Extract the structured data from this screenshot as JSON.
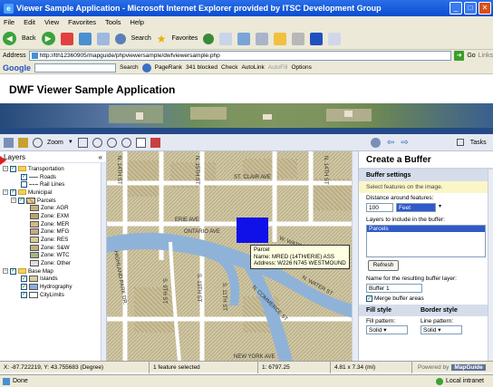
{
  "window": {
    "title": "Viewer Sample Application - Microsoft Internet Explorer provided by ITSC Development Group"
  },
  "menu": [
    "File",
    "Edit",
    "View",
    "Favorites",
    "Tools",
    "Help"
  ],
  "toolbar": {
    "back": "Back",
    "search": "Search",
    "favorites": "Favorites"
  },
  "address": {
    "label": "Address",
    "url": "http://lth12360905/mapguide/phpviewersample/dwfviewersample.php",
    "go": "Go",
    "links": "Links"
  },
  "google": {
    "logo": "Google",
    "search": "Search",
    "pagerank": "PageRank",
    "blocked": "341 blocked",
    "check": "Check",
    "autolink": "AutoLink",
    "autofill": "AutoFill",
    "options": "Options"
  },
  "app": {
    "title": "DWF Viewer Sample Application"
  },
  "maptoolbar": {
    "zoom": "Zoom"
  },
  "tasks": {
    "label": "Tasks"
  },
  "layers": {
    "title": "Layers",
    "groups": [
      {
        "name": "Transportation",
        "items": [
          "Roads",
          "Rail Lines"
        ]
      },
      {
        "name": "Municipal",
        "sub": "Parcels",
        "zones": [
          {
            "label": "Zone: AGR",
            "color": "#c8b27c"
          },
          {
            "label": "Zone: EXM",
            "color": "#b6a66e"
          },
          {
            "label": "Zone: MER",
            "color": "#d6b98a"
          },
          {
            "label": "Zone: MFG",
            "color": "#c9a986"
          },
          {
            "label": "Zone: RES",
            "color": "#d8cc9c"
          },
          {
            "label": "Zone: S&W",
            "color": "#bfb07e"
          },
          {
            "label": "Zone: WTC",
            "color": "#a8b484"
          },
          {
            "label": "Zone: Other",
            "color": "#e0e0e0"
          }
        ]
      },
      {
        "name": "Base Map",
        "items": [
          "Islands",
          "Hydrography",
          "CityLimits"
        ]
      }
    ]
  },
  "map": {
    "streets": [
      "ST. CLAIR AVE",
      "ERIE AVE",
      "ONTARIO AVE",
      "W. WATER ST",
      "N. WATER ST",
      "N. COMMERCE ST",
      "NEW YORK AVE",
      "HIGHLAND PARK DR.",
      "N. 14TH ST",
      "N. 15TH ST",
      "N. 14TH ST",
      "S. 13TH ST",
      "S. 11TH ST",
      "S. 9TH ST"
    ],
    "tooltip": {
      "title": "Parcel",
      "name": "Name: MRED (14TH/ERIE) ASS",
      "address": "Address: W226 N745 WESTMOUND"
    }
  },
  "taskpane": {
    "title": "Create a Buffer",
    "section1": "Buffer settings",
    "note": "Select features on the image.",
    "distance_label": "Distance around features:",
    "distance_value": "100",
    "unit": "Feet",
    "layers_label": "Layers to include in the buffer:",
    "layer_option": "Parcels",
    "refresh": "Refresh",
    "name_label": "Name for the resulting buffer layer:",
    "name_value": "Buffer 1",
    "merge": "Merge buffer areas",
    "fill_style": "Fill style",
    "border_style": "Border style",
    "fill_pattern": "Fill pattern:",
    "line_pattern": "Line pattern:",
    "solid1": "Solid",
    "solid2": "Solid"
  },
  "status": {
    "coords": "X: -87.722219, Y: 43.755683 (Degree)",
    "selected": "1 feature selected",
    "scale": "1: 6797.25",
    "size": "4.81 x 7.34 (mi)",
    "powered": "Powered by",
    "brand": "MapGuide"
  },
  "iestatus": {
    "done": "Done",
    "zone": "Local intranet"
  }
}
